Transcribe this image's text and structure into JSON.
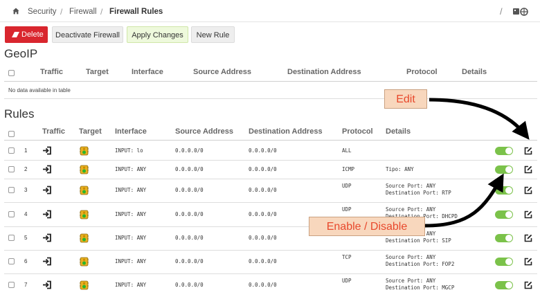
{
  "breadcrumb": {
    "items": [
      "Security",
      "Firewall",
      "Firewall Rules"
    ],
    "separator": "/",
    "right_separator": "/"
  },
  "toolbar": {
    "delete_label": "Delete",
    "deactivate_label": "Deactivate Firewall",
    "apply_label": "Apply Changes",
    "new_rule_label": "New Rule"
  },
  "geoip": {
    "title": "GeoIP",
    "columns": [
      "Traffic",
      "Target",
      "Interface",
      "Source Address",
      "Destination Address",
      "Protocol",
      "Details"
    ],
    "empty_text": "No data available in table"
  },
  "rules": {
    "title": "Rules",
    "columns": [
      "Traffic",
      "Target",
      "Interface",
      "Source Address",
      "Destination Address",
      "Protocol",
      "Details"
    ],
    "rows": [
      {
        "num": "1",
        "interface": "INPUT: lo",
        "source": "0.0.0.0/0",
        "destination": "0.0.0.0/0",
        "protocol": "ALL",
        "details": [
          "",
          ""
        ],
        "enabled": true
      },
      {
        "num": "2",
        "interface": "INPUT: ANY",
        "source": "0.0.0.0/0",
        "destination": "0.0.0.0/0",
        "protocol": "ICMP",
        "details": [
          "Tipo: ANY",
          ""
        ],
        "enabled": true
      },
      {
        "num": "3",
        "interface": "INPUT: ANY",
        "source": "0.0.0.0/0",
        "destination": "0.0.0.0/0",
        "protocol": "UDP",
        "details": [
          "Source Port: ANY",
          "Destination Port: RTP"
        ],
        "enabled": true
      },
      {
        "num": "4",
        "interface": "INPUT: ANY",
        "source": "0.0.0.0/0",
        "destination": "0.0.0.0/0",
        "protocol": "UDP",
        "details": [
          "Source Port: ANY",
          "Destination Port: DHCPD"
        ],
        "enabled": true
      },
      {
        "num": "5",
        "interface": "INPUT: ANY",
        "source": "0.0.0.0/0",
        "destination": "0.0.0.0/0",
        "protocol": "UDP",
        "details": [
          "Source Port: ANY",
          "Destination Port: SIP"
        ],
        "enabled": true
      },
      {
        "num": "6",
        "interface": "INPUT: ANY",
        "source": "0.0.0.0/0",
        "destination": "0.0.0.0/0",
        "protocol": "TCP",
        "details": [
          "Source Port: ANY",
          "Destination Port: FOP2"
        ],
        "enabled": true
      },
      {
        "num": "7",
        "interface": "INPUT: ANY",
        "source": "0.0.0.0/0",
        "destination": "0.0.0.0/0",
        "protocol": "UDP",
        "details": [
          "Source Port: ANY",
          "Destination Port: MGCP"
        ],
        "enabled": true
      }
    ]
  },
  "annotations": {
    "edit": "Edit",
    "enable_disable": "Enable / Disable"
  },
  "colors": {
    "delete_button": "#d9262e",
    "apply_button": "#eef9dc",
    "toggle_on": "#7bc24a",
    "annotation_bg": "#f8d7bd",
    "annotation_text": "#e8482c"
  },
  "icons": {
    "home": "home-icon",
    "delete": "eraser-icon",
    "traffic": "sign-in-icon",
    "target": "traffic-light-icon",
    "edit": "edit-icon",
    "right": "grid-icon"
  }
}
